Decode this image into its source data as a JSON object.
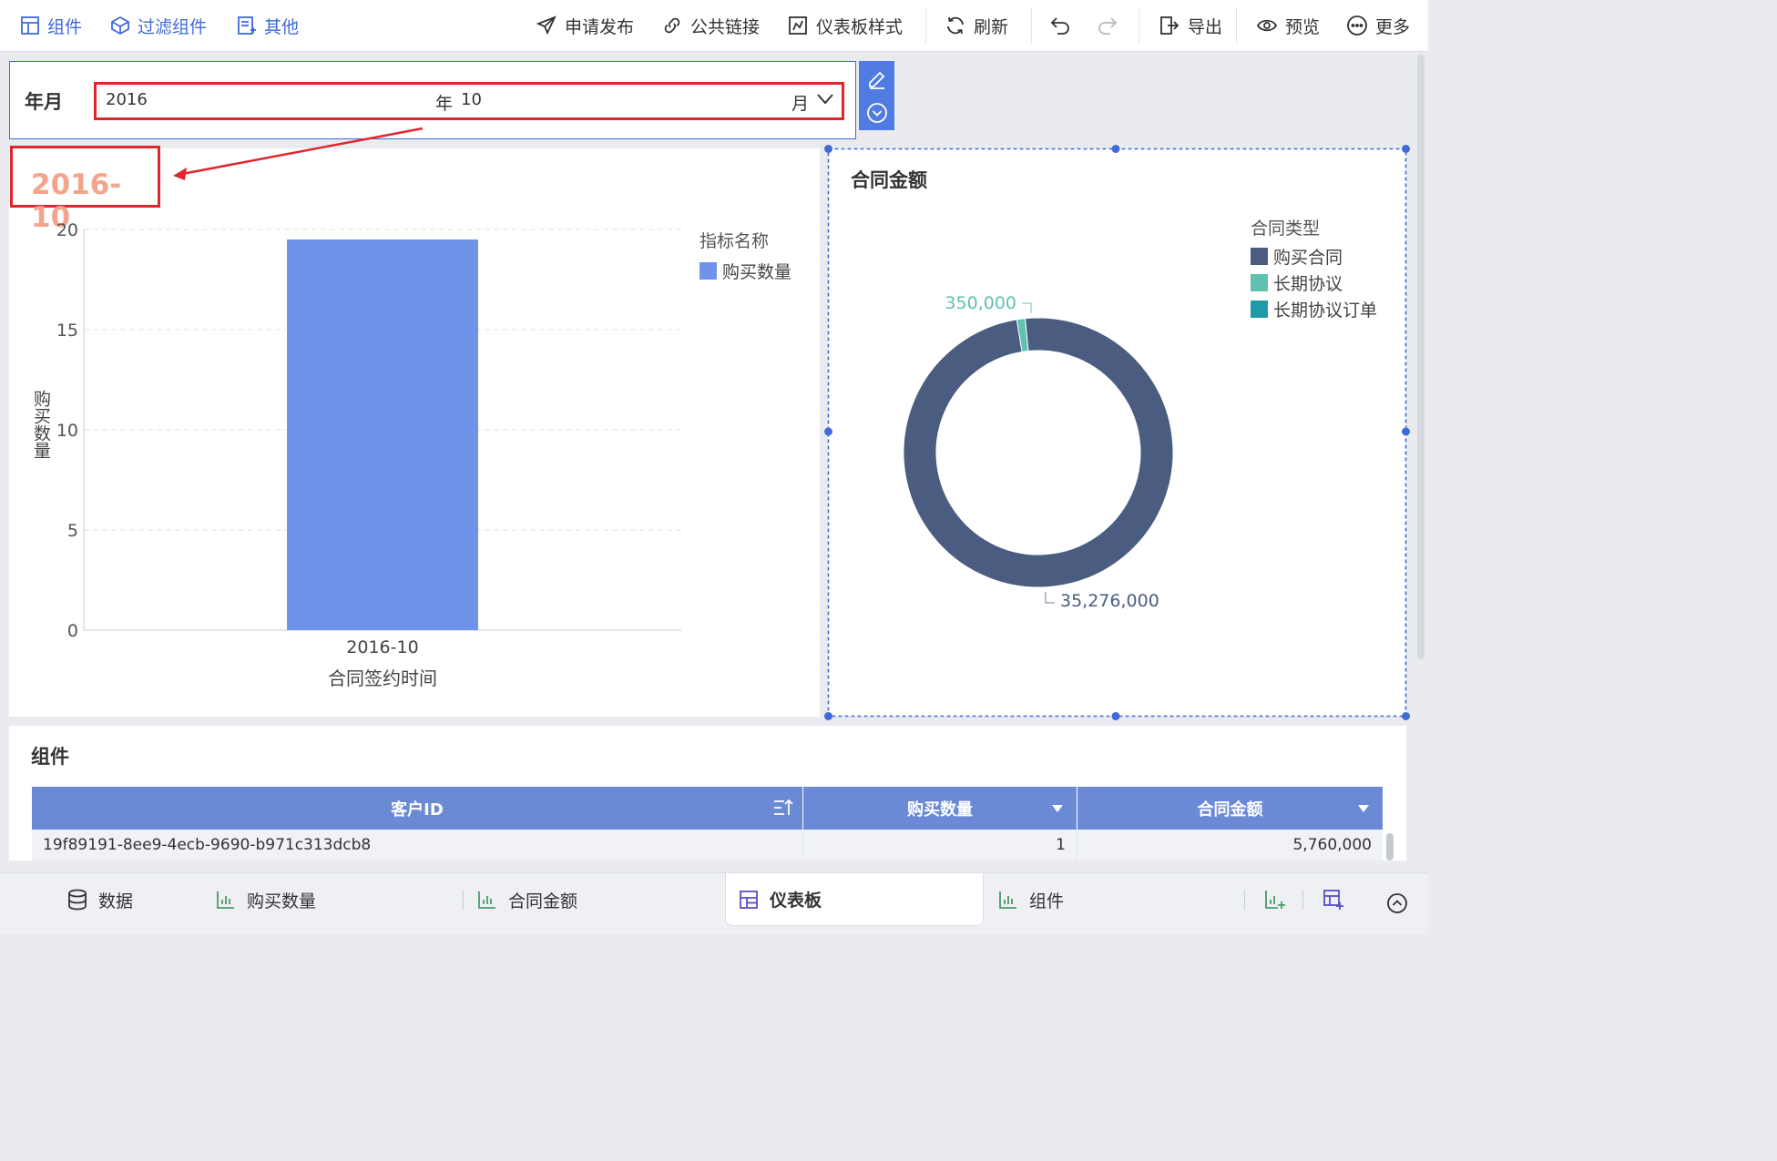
{
  "toolbar": {
    "left": [
      {
        "label": "组件",
        "icon": "component-icon"
      },
      {
        "label": "过滤组件",
        "icon": "filter-component-icon"
      },
      {
        "label": "其他",
        "icon": "other-icon"
      }
    ],
    "publish": "申请发布",
    "public_link": "公共链接",
    "dashboard_style": "仪表板样式",
    "refresh": "刷新",
    "export": "导出",
    "preview": "预览",
    "more": "更多"
  },
  "filter": {
    "label": "年月",
    "year": "2016",
    "year_unit": "年",
    "month": "10",
    "month_unit": "月"
  },
  "annotation": {
    "value": "2016-10",
    "color": "#f4a48c"
  },
  "bar_chart": {
    "legend_title": "指标名称",
    "chart_data": {
      "type": "bar",
      "categories": [
        "2016-10"
      ],
      "series": [
        {
          "name": "购买数量",
          "values": [
            19.5
          ]
        }
      ],
      "xlabel": "合同签约时间",
      "ylabel": "购买数量",
      "ylim": [
        0,
        20
      ],
      "yticks": [
        "0",
        "5",
        "10",
        "15",
        "20"
      ],
      "grid": true,
      "legend": "top-right",
      "color": "#7093ea"
    }
  },
  "pie_chart": {
    "title": "合同金额",
    "legend_title": "合同类型",
    "chart_data": {
      "type": "pie",
      "donut": true,
      "slices": [
        {
          "name": "购买合同",
          "value": 35276000,
          "label": "35,276,000",
          "color": "#4a5c80"
        },
        {
          "name": "长期协议",
          "value": 350000,
          "label": "350,000",
          "color": "#5fc1b0"
        },
        {
          "name": "长期协议订单",
          "value": 0,
          "label": "",
          "color": "#1f9aa8"
        }
      ],
      "legend": "top-right"
    }
  },
  "table": {
    "title": "组件",
    "columns": [
      "客户ID",
      "购买数量",
      "合同金额"
    ],
    "rows": [
      [
        "19f89191-8ee9-4ecb-9690-b971c313dcb8",
        "1",
        "5,760,000"
      ]
    ]
  },
  "bottom_tabs": [
    {
      "label": "数据",
      "icon": "database-icon"
    },
    {
      "label": "购买数量",
      "icon": "bar-chart-icon"
    },
    {
      "label": "合同金额",
      "icon": "bar-chart-icon"
    },
    {
      "label": "仪表板",
      "icon": "dashboard-icon",
      "active": true
    },
    {
      "label": "组件",
      "icon": "bar-chart-icon"
    }
  ]
}
